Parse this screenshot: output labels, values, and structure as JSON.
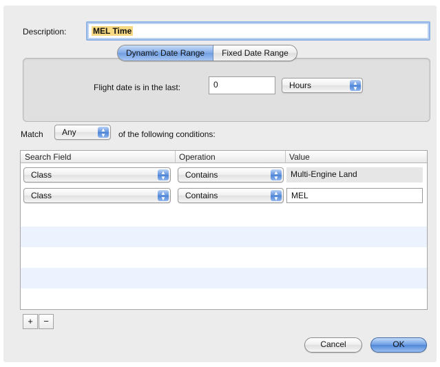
{
  "description": {
    "label": "Description:",
    "value": "MEL Time"
  },
  "range_tabs": {
    "dynamic": "Dynamic Date Range",
    "fixed": "Fixed Date Range",
    "selected": "dynamic"
  },
  "flight_date": {
    "label": "Flight date is in the last:",
    "value": "0",
    "unit": "Hours"
  },
  "match": {
    "label": "Match",
    "value": "Any",
    "suffix": "of the following conditions:"
  },
  "table": {
    "columns": [
      "Search Field",
      "Operation",
      "Value"
    ],
    "rows": [
      {
        "field": "Class",
        "operation": "Contains",
        "value": "Multi-Engine Land"
      },
      {
        "field": "Class",
        "operation": "Contains",
        "value": "MEL"
      }
    ]
  },
  "buttons": {
    "add": "+",
    "remove": "−",
    "cancel": "Cancel",
    "ok": "OK"
  },
  "colors": {
    "accent": "#5f92dc",
    "highlight": "#f7d983",
    "row_alt": "#edf3fe"
  }
}
